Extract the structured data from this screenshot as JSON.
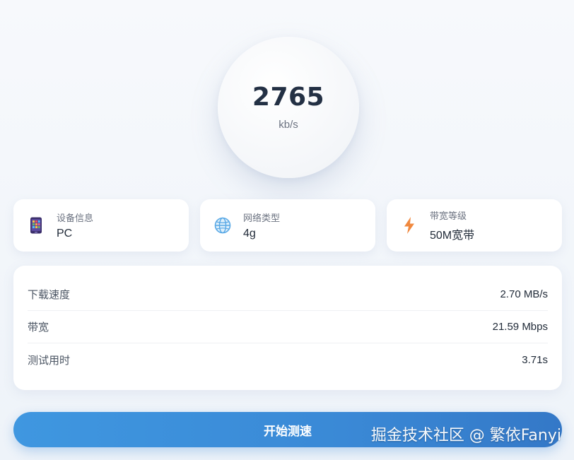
{
  "speed": {
    "value": "2765",
    "unit": "kb/s"
  },
  "info_cards": [
    {
      "label": "设备信息",
      "value": "PC",
      "icon": "phone-icon"
    },
    {
      "label": "网络类型",
      "value": "4g",
      "icon": "globe-icon"
    },
    {
      "label": "带宽等级",
      "value": "50M宽带",
      "icon": "lightning-icon"
    }
  ],
  "stats": [
    {
      "label": "下载速度",
      "value": "2.70 MB/s"
    },
    {
      "label": "带宽",
      "value": "21.59 Mbps"
    },
    {
      "label": "测试用时",
      "value": "3.71s"
    }
  ],
  "start_button": {
    "label": "开始测速"
  },
  "watermark": "掘金技术社区 @ 繁依Fanyi",
  "colors": {
    "accent": "#3a89d6",
    "lightning": "#f0883e",
    "globe": "#5aa9e6"
  }
}
